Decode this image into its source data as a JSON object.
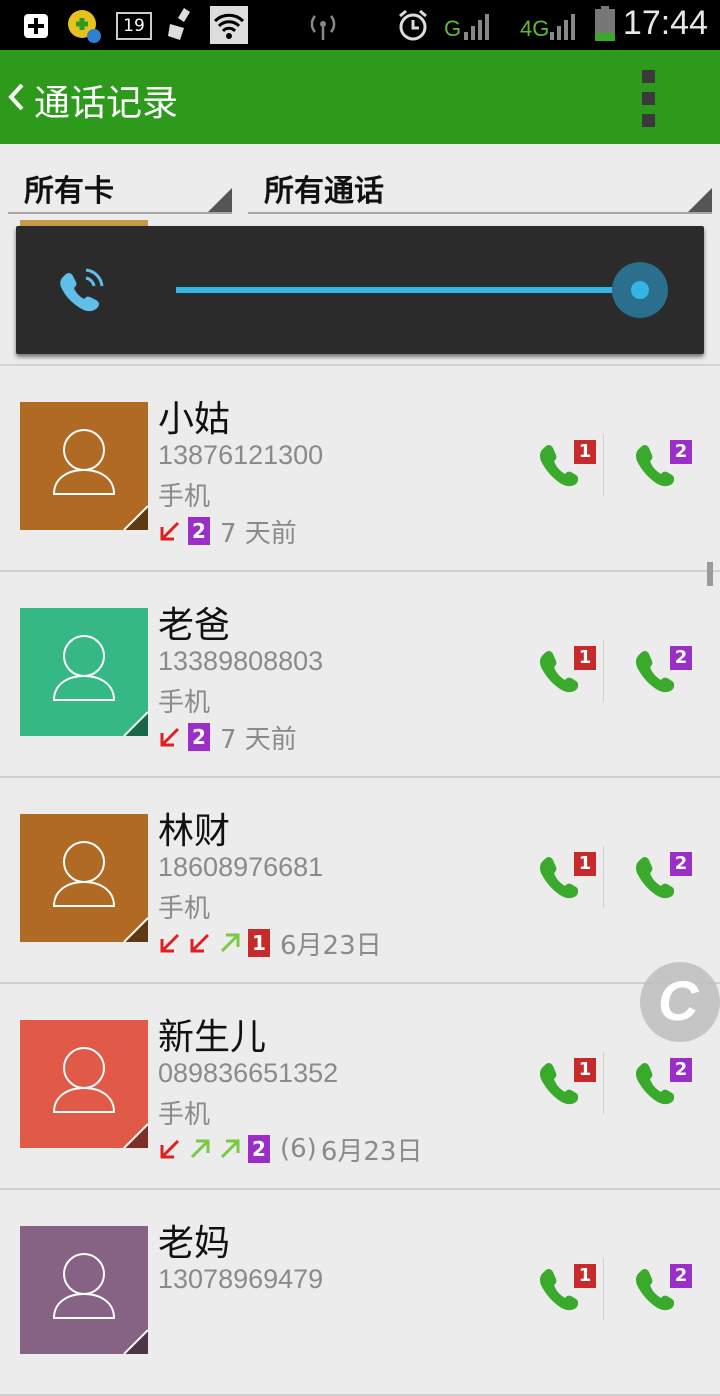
{
  "status_bar": {
    "time": "17:44",
    "notification_count": "19",
    "network_label": "4G",
    "signal_label": "G",
    "icons": [
      "add-icon",
      "app-icon",
      "calendar-icon",
      "clean-icon",
      "wifi-icon",
      "hotspot-icon",
      "alarm-icon",
      "signal-icon",
      "battery-icon"
    ]
  },
  "app_bar": {
    "title": "通话记录"
  },
  "filters": {
    "sim_filter": "所有卡",
    "call_filter": "所有通话"
  },
  "volume_panel": {
    "level_fraction": 1.0,
    "accent_color": "#33b5e5"
  },
  "calls": [
    {
      "name": "小姑",
      "number": "13876121300",
      "type": "手机",
      "direction_icons": [
        "missed"
      ],
      "sim": "2",
      "count": "",
      "time": "7 天前",
      "avatar_color": "#b06a23"
    },
    {
      "name": "老爸",
      "number": "13389808803",
      "type": "手机",
      "direction_icons": [
        "missed"
      ],
      "sim": "2",
      "count": "",
      "time": "7 天前",
      "avatar_color": "#36b884"
    },
    {
      "name": "林财",
      "number": "18608976681",
      "type": "手机",
      "direction_icons": [
        "missed",
        "missed",
        "outgoing"
      ],
      "sim": "1",
      "count": "",
      "time": "6月23日",
      "avatar_color": "#b06a23"
    },
    {
      "name": "新生儿",
      "number": "089836651352",
      "type": "手机",
      "direction_icons": [
        "missed",
        "outgoing",
        "outgoing"
      ],
      "sim": "2",
      "count": "(6)",
      "time": "6月23日",
      "avatar_color": "#e05a47"
    },
    {
      "name": "老妈",
      "number": "13078969479",
      "type": "",
      "direction_icons": [],
      "sim": "",
      "count": "",
      "time": "",
      "avatar_color": "#866385"
    }
  ],
  "call_buttons": {
    "sim1_label": "1",
    "sim2_label": "2"
  },
  "colors": {
    "app_bar": "#2e9a1c",
    "call_green": "#3aaa2c",
    "sim1": "#c62a2a",
    "sim2": "#9a2ec7",
    "missed": "#e02020",
    "outgoing": "#7ac943"
  },
  "floating_button": {
    "label": "C"
  }
}
